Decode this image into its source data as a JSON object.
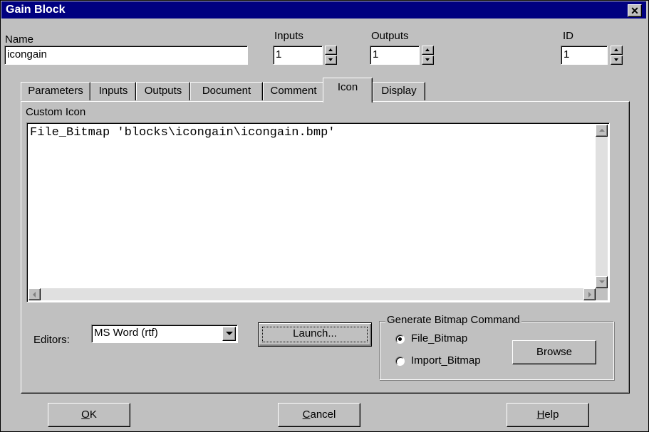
{
  "window": {
    "title": "Gain Block",
    "close_glyph": "✕"
  },
  "fields": {
    "name": {
      "label": "Name",
      "value": "icongain"
    },
    "inputs": {
      "label": "Inputs",
      "value": "1"
    },
    "outputs": {
      "label": "Outputs",
      "value": "1"
    },
    "id": {
      "label": "ID",
      "value": "1"
    }
  },
  "tabs": [
    {
      "label": "Parameters"
    },
    {
      "label": "Inputs"
    },
    {
      "label": "Outputs"
    },
    {
      "label": "Document"
    },
    {
      "label": "Comment"
    },
    {
      "label": "Icon",
      "active": true
    },
    {
      "label": "Display"
    }
  ],
  "icon_tab": {
    "custom_icon_label": "Custom Icon",
    "text": "File_Bitmap 'blocks\\icongain\\icongain.bmp'",
    "editors_label": "Editors:",
    "editor_selected": "MS Word  (rtf)",
    "launch_label": "Launch...",
    "group_title": "Generate Bitmap Command",
    "radio_file": "File_Bitmap",
    "radio_import": "Import_Bitmap",
    "radio_selected": "File_Bitmap",
    "browse_label": "Browse"
  },
  "buttons": {
    "ok": {
      "mnemonic": "O",
      "rest": "K"
    },
    "cancel": {
      "mnemonic": "C",
      "rest": "ancel"
    },
    "help": {
      "mnemonic": "H",
      "rest": "elp"
    }
  },
  "icons": [
    "close-icon",
    "spin-up-icon",
    "spin-down-icon",
    "dropdown-arrow-icon",
    "scroll-up-icon",
    "scroll-down-icon",
    "scroll-left-icon",
    "scroll-right-icon",
    "radio-selected-icon"
  ]
}
